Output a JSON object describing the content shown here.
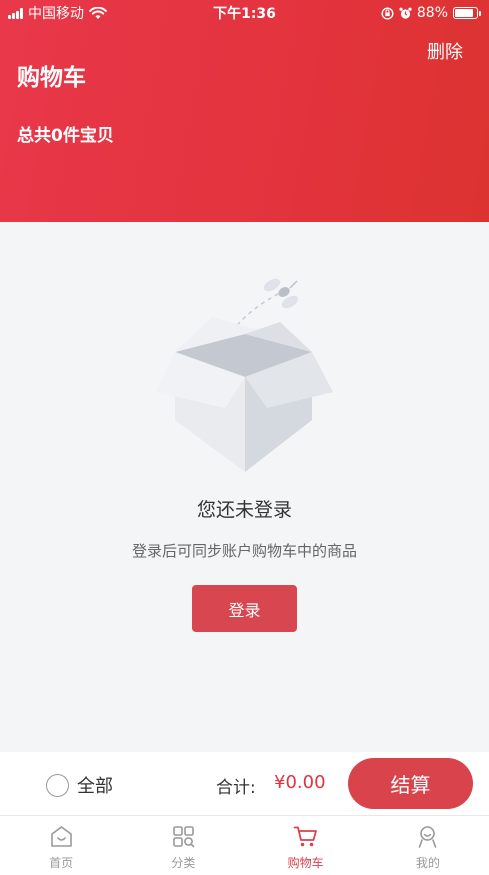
{
  "status_bar": {
    "carrier": "中国移动",
    "time": "下午1:36",
    "battery_text": "88%",
    "battery_level": 0.88
  },
  "header": {
    "title": "购物车",
    "delete_label": "删除",
    "total_text": "总共0件宝贝"
  },
  "empty_state": {
    "title": "您还未登录",
    "description": "登录后可同步账户购物车中的商品",
    "login_label": "登录",
    "illustration": "empty-box-with-bee"
  },
  "checkout": {
    "select_all_label": "全部",
    "sum_label": "合计:",
    "sum_value": "¥0.00",
    "checkout_label": "结算"
  },
  "tabbar": {
    "items": [
      {
        "label": "首页",
        "icon": "home-icon"
      },
      {
        "label": "分类",
        "icon": "category-icon"
      },
      {
        "label": "购物车",
        "icon": "cart-icon",
        "active": true
      },
      {
        "label": "我的",
        "icon": "profile-icon"
      }
    ]
  },
  "colors": {
    "accent": "#d8434c",
    "header_gradient_start": "#e8384a",
    "header_gradient_end": "#dc3330",
    "background": "#f4f5f7"
  }
}
